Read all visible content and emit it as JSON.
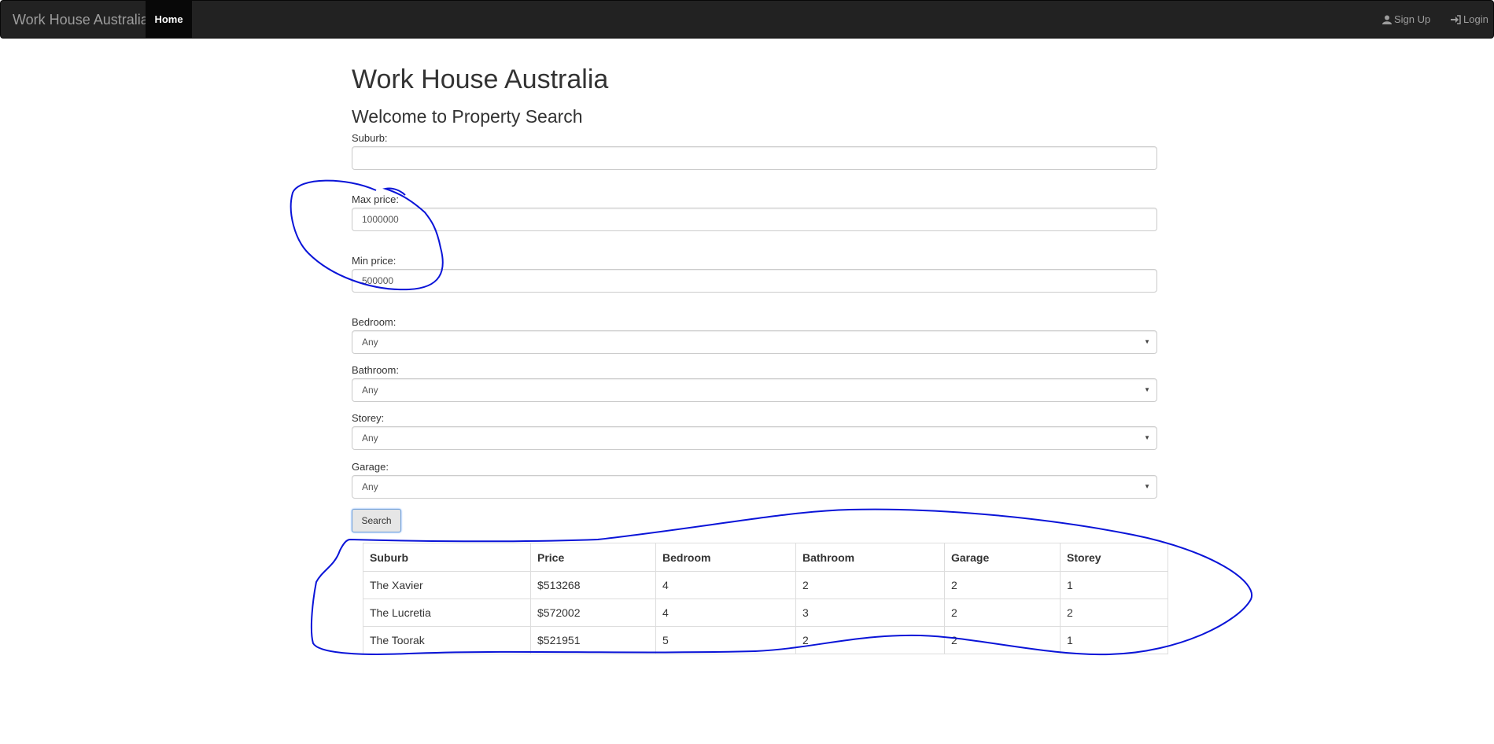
{
  "navbar": {
    "brand": "Work House Australia",
    "home": "Home",
    "signup": "Sign Up",
    "login": "Login"
  },
  "page": {
    "title": "Work House Australia",
    "subtitle": "Welcome to Property Search"
  },
  "form": {
    "suburb_label": "Suburb:",
    "suburb_value": "",
    "max_price_label": "Max price:",
    "max_price_value": "1000000",
    "min_price_label": "Min price:",
    "min_price_value": "500000",
    "bedroom_label": "Bedroom:",
    "bedroom_value": "Any",
    "bathroom_label": "Bathroom:",
    "bathroom_value": "Any",
    "storey_label": "Storey:",
    "storey_value": "Any",
    "garage_label": "Garage:",
    "garage_value": "Any",
    "search_button": "Search"
  },
  "results": {
    "headers": [
      "Suburb",
      "Price",
      "Bedroom",
      "Bathroom",
      "Garage",
      "Storey"
    ],
    "rows": [
      [
        "The Xavier",
        "$513268",
        "4",
        "2",
        "2",
        "1"
      ],
      [
        "The Lucretia",
        "$572002",
        "4",
        "3",
        "2",
        "2"
      ],
      [
        "The Toorak",
        "$521951",
        "5",
        "2",
        "2",
        "1"
      ]
    ]
  },
  "annotation_color": "#0a14d8"
}
